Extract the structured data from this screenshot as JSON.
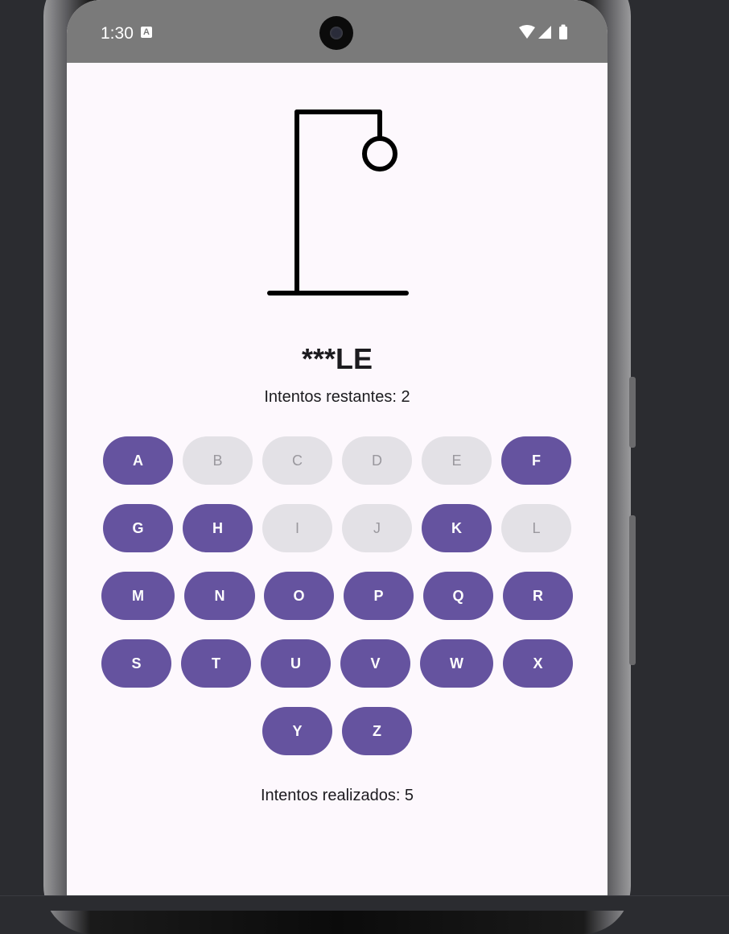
{
  "status_bar": {
    "time": "1:30",
    "notification_icon": "a-icon",
    "icons": [
      "wifi-icon",
      "signal-icon",
      "battery-icon"
    ]
  },
  "game": {
    "word": "***LE",
    "remaining_label": "Intentos restantes: 2",
    "attempts_label": "Intentos realizados: 5"
  },
  "keyboard": {
    "keys": [
      {
        "letter": "A",
        "enabled": true
      },
      {
        "letter": "B",
        "enabled": false
      },
      {
        "letter": "C",
        "enabled": false
      },
      {
        "letter": "D",
        "enabled": false
      },
      {
        "letter": "E",
        "enabled": false
      },
      {
        "letter": "F",
        "enabled": true
      },
      {
        "letter": "G",
        "enabled": true
      },
      {
        "letter": "H",
        "enabled": true
      },
      {
        "letter": "I",
        "enabled": false
      },
      {
        "letter": "J",
        "enabled": false
      },
      {
        "letter": "K",
        "enabled": true
      },
      {
        "letter": "L",
        "enabled": false
      },
      {
        "letter": "M",
        "enabled": true
      },
      {
        "letter": "N",
        "enabled": true
      },
      {
        "letter": "O",
        "enabled": true
      },
      {
        "letter": "P",
        "enabled": true
      },
      {
        "letter": "Q",
        "enabled": true
      },
      {
        "letter": "R",
        "enabled": true
      },
      {
        "letter": "S",
        "enabled": true
      },
      {
        "letter": "T",
        "enabled": true
      },
      {
        "letter": "U",
        "enabled": true
      },
      {
        "letter": "V",
        "enabled": true
      },
      {
        "letter": "W",
        "enabled": true
      },
      {
        "letter": "X",
        "enabled": true
      },
      {
        "letter": "Y",
        "enabled": true
      },
      {
        "letter": "Z",
        "enabled": true
      }
    ]
  },
  "colors": {
    "key_enabled_bg": "#65539f",
    "key_disabled_bg": "#e3e1e6",
    "screen_bg": "#fdf8fd",
    "status_bar_bg": "#7a7a7a"
  }
}
